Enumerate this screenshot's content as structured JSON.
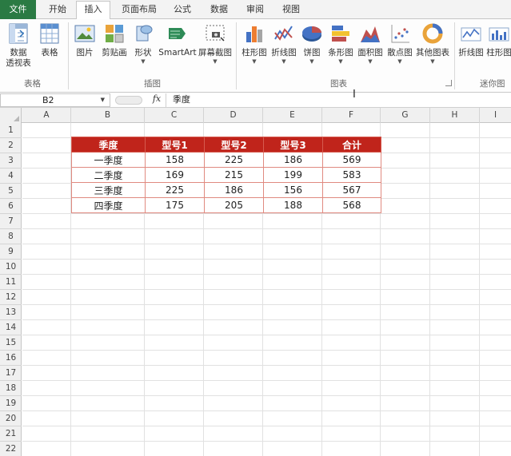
{
  "tabs": [
    "文件",
    "开始",
    "插入",
    "页面布局",
    "公式",
    "数据",
    "审阅",
    "视图"
  ],
  "active_tab": "插入",
  "ribbon": {
    "groups": {
      "tables": "表格",
      "illustrations": "插图",
      "charts": "图表",
      "sparklines": "迷你图"
    },
    "buttons": {
      "pivot_line1": "数据",
      "pivot_line2": "透视表",
      "table": "表格",
      "picture": "图片",
      "clipart": "剪贴画",
      "shapes": "形状",
      "smartart": "SmartArt",
      "screenshot": "屏幕截图",
      "column_chart": "柱形图",
      "line_chart": "折线图",
      "pie_chart": "饼图",
      "bar_chart": "条形图",
      "area_chart": "面积图",
      "scatter_chart": "散点图",
      "other_charts": "其他图表",
      "spark_line": "折线图",
      "spark_column": "柱形图"
    }
  },
  "formula_bar": {
    "name_box": "B2",
    "fx": "fx",
    "content": "季度"
  },
  "columns": [
    "A",
    "B",
    "C",
    "D",
    "E",
    "F",
    "G",
    "H",
    "I"
  ],
  "rows": [
    "1",
    "2",
    "3",
    "4",
    "5",
    "6",
    "7",
    "8",
    "9",
    "10",
    "11",
    "12",
    "13",
    "14",
    "15",
    "16",
    "17",
    "18",
    "19",
    "20",
    "21",
    "22"
  ],
  "table": {
    "headers": [
      "季度",
      "型号1",
      "型号2",
      "型号3",
      "合计"
    ],
    "rows": [
      [
        "一季度",
        "158",
        "225",
        "186",
        "569"
      ],
      [
        "二季度",
        "169",
        "215",
        "199",
        "583"
      ],
      [
        "三季度",
        "225",
        "186",
        "156",
        "567"
      ],
      [
        "四季度",
        "175",
        "205",
        "188",
        "568"
      ]
    ]
  },
  "colors": {
    "file_tab": "#2a7a43",
    "header_fill": "#c0241b",
    "border": "#e08a80"
  }
}
